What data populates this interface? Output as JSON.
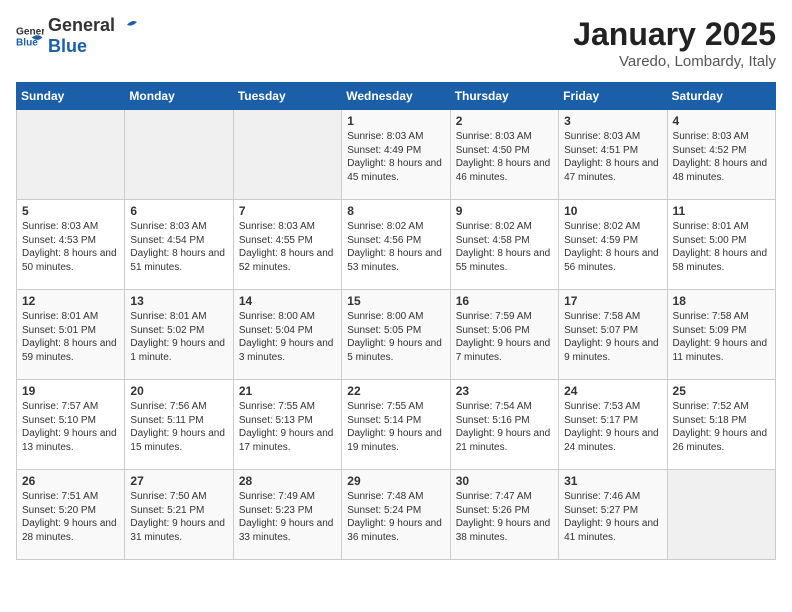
{
  "logo": {
    "general": "General",
    "blue": "Blue"
  },
  "title": "January 2025",
  "subtitle": "Varedo, Lombardy, Italy",
  "days_of_week": [
    "Sunday",
    "Monday",
    "Tuesday",
    "Wednesday",
    "Thursday",
    "Friday",
    "Saturday"
  ],
  "weeks": [
    [
      {
        "day": "",
        "info": ""
      },
      {
        "day": "",
        "info": ""
      },
      {
        "day": "",
        "info": ""
      },
      {
        "day": "1",
        "info": "Sunrise: 8:03 AM\nSunset: 4:49 PM\nDaylight: 8 hours and 45 minutes."
      },
      {
        "day": "2",
        "info": "Sunrise: 8:03 AM\nSunset: 4:50 PM\nDaylight: 8 hours and 46 minutes."
      },
      {
        "day": "3",
        "info": "Sunrise: 8:03 AM\nSunset: 4:51 PM\nDaylight: 8 hours and 47 minutes."
      },
      {
        "day": "4",
        "info": "Sunrise: 8:03 AM\nSunset: 4:52 PM\nDaylight: 8 hours and 48 minutes."
      }
    ],
    [
      {
        "day": "5",
        "info": "Sunrise: 8:03 AM\nSunset: 4:53 PM\nDaylight: 8 hours and 50 minutes."
      },
      {
        "day": "6",
        "info": "Sunrise: 8:03 AM\nSunset: 4:54 PM\nDaylight: 8 hours and 51 minutes."
      },
      {
        "day": "7",
        "info": "Sunrise: 8:03 AM\nSunset: 4:55 PM\nDaylight: 8 hours and 52 minutes."
      },
      {
        "day": "8",
        "info": "Sunrise: 8:02 AM\nSunset: 4:56 PM\nDaylight: 8 hours and 53 minutes."
      },
      {
        "day": "9",
        "info": "Sunrise: 8:02 AM\nSunset: 4:58 PM\nDaylight: 8 hours and 55 minutes."
      },
      {
        "day": "10",
        "info": "Sunrise: 8:02 AM\nSunset: 4:59 PM\nDaylight: 8 hours and 56 minutes."
      },
      {
        "day": "11",
        "info": "Sunrise: 8:01 AM\nSunset: 5:00 PM\nDaylight: 8 hours and 58 minutes."
      }
    ],
    [
      {
        "day": "12",
        "info": "Sunrise: 8:01 AM\nSunset: 5:01 PM\nDaylight: 8 hours and 59 minutes."
      },
      {
        "day": "13",
        "info": "Sunrise: 8:01 AM\nSunset: 5:02 PM\nDaylight: 9 hours and 1 minute."
      },
      {
        "day": "14",
        "info": "Sunrise: 8:00 AM\nSunset: 5:04 PM\nDaylight: 9 hours and 3 minutes."
      },
      {
        "day": "15",
        "info": "Sunrise: 8:00 AM\nSunset: 5:05 PM\nDaylight: 9 hours and 5 minutes."
      },
      {
        "day": "16",
        "info": "Sunrise: 7:59 AM\nSunset: 5:06 PM\nDaylight: 9 hours and 7 minutes."
      },
      {
        "day": "17",
        "info": "Sunrise: 7:58 AM\nSunset: 5:07 PM\nDaylight: 9 hours and 9 minutes."
      },
      {
        "day": "18",
        "info": "Sunrise: 7:58 AM\nSunset: 5:09 PM\nDaylight: 9 hours and 11 minutes."
      }
    ],
    [
      {
        "day": "19",
        "info": "Sunrise: 7:57 AM\nSunset: 5:10 PM\nDaylight: 9 hours and 13 minutes."
      },
      {
        "day": "20",
        "info": "Sunrise: 7:56 AM\nSunset: 5:11 PM\nDaylight: 9 hours and 15 minutes."
      },
      {
        "day": "21",
        "info": "Sunrise: 7:55 AM\nSunset: 5:13 PM\nDaylight: 9 hours and 17 minutes."
      },
      {
        "day": "22",
        "info": "Sunrise: 7:55 AM\nSunset: 5:14 PM\nDaylight: 9 hours and 19 minutes."
      },
      {
        "day": "23",
        "info": "Sunrise: 7:54 AM\nSunset: 5:16 PM\nDaylight: 9 hours and 21 minutes."
      },
      {
        "day": "24",
        "info": "Sunrise: 7:53 AM\nSunset: 5:17 PM\nDaylight: 9 hours and 24 minutes."
      },
      {
        "day": "25",
        "info": "Sunrise: 7:52 AM\nSunset: 5:18 PM\nDaylight: 9 hours and 26 minutes."
      }
    ],
    [
      {
        "day": "26",
        "info": "Sunrise: 7:51 AM\nSunset: 5:20 PM\nDaylight: 9 hours and 28 minutes."
      },
      {
        "day": "27",
        "info": "Sunrise: 7:50 AM\nSunset: 5:21 PM\nDaylight: 9 hours and 31 minutes."
      },
      {
        "day": "28",
        "info": "Sunrise: 7:49 AM\nSunset: 5:23 PM\nDaylight: 9 hours and 33 minutes."
      },
      {
        "day": "29",
        "info": "Sunrise: 7:48 AM\nSunset: 5:24 PM\nDaylight: 9 hours and 36 minutes."
      },
      {
        "day": "30",
        "info": "Sunrise: 7:47 AM\nSunset: 5:26 PM\nDaylight: 9 hours and 38 minutes."
      },
      {
        "day": "31",
        "info": "Sunrise: 7:46 AM\nSunset: 5:27 PM\nDaylight: 9 hours and 41 minutes."
      },
      {
        "day": "",
        "info": ""
      }
    ]
  ]
}
